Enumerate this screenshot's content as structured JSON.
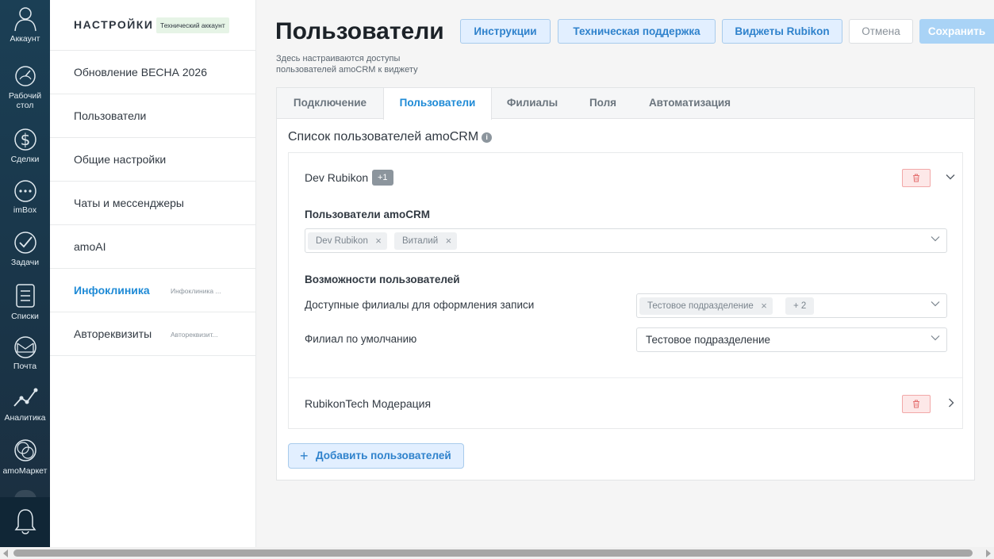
{
  "nav": {
    "account": "Аккаунт",
    "dashboard_line1": "Рабочий",
    "dashboard_line2": "стол",
    "deals": "Сделки",
    "inbox": "imBox",
    "tasks": "Задачи",
    "lists": "Списки",
    "mail": "Почта",
    "analytics": "Аналитика",
    "market": "amoМаркет"
  },
  "sidebar": {
    "title": "НАСТРОЙКИ",
    "badge": "Технический аккаунт",
    "items": [
      {
        "label": "Обновление ВЕСНА 2026",
        "sub": ""
      },
      {
        "label": "Пользователи",
        "sub": ""
      },
      {
        "label": "Общие настройки",
        "sub": ""
      },
      {
        "label": "Чаты и мессенджеры",
        "sub": ""
      },
      {
        "label": "amoAI",
        "sub": ""
      },
      {
        "label": "Инфоклиника",
        "sub": "Инфоклиника ..."
      },
      {
        "label": "Автореквизиты",
        "sub": "Автореквизит..."
      }
    ]
  },
  "header": {
    "title": "Пользователи",
    "description": "Здесь настраиваются доступы пользователей amoCRM к виджету",
    "buttons": {
      "instructions": "Инструкции",
      "support": "Техническая поддержка",
      "widgets": "Виджеты Rubikon",
      "cancel": "Отмена",
      "save": "Сохранить"
    }
  },
  "tabs": [
    "Подключение",
    "Пользователи",
    "Филиалы",
    "Поля",
    "Автоматизация"
  ],
  "active_tab": "Пользователи",
  "list": {
    "title": "Список пользователей amoCRM",
    "info_icon": "i",
    "groups": [
      {
        "name": "Dev Rubikon",
        "badge": "+1",
        "expanded": true,
        "amocrm_users_title": "Пользователи amoCRM",
        "users": [
          "Dev Rubikon",
          "Виталий"
        ],
        "capabilities_title": "Возможности пользователей",
        "branches_label": "Доступные филиалы для оформления записи",
        "branches": [
          "Тестовое подразделение"
        ],
        "branches_more": "+ 2",
        "default_branch_label": "Филиал по умолчанию",
        "default_branch": "Тестовое подразделение"
      },
      {
        "name": "RubikonTech Модерация",
        "expanded": false
      }
    ],
    "add_button": "Добавить пользователей",
    "add_plus": "+"
  },
  "colors": {
    "accent": "#1e8ad6",
    "nav_bg": "#1b3f55",
    "danger_bg": "#fde8e8"
  }
}
